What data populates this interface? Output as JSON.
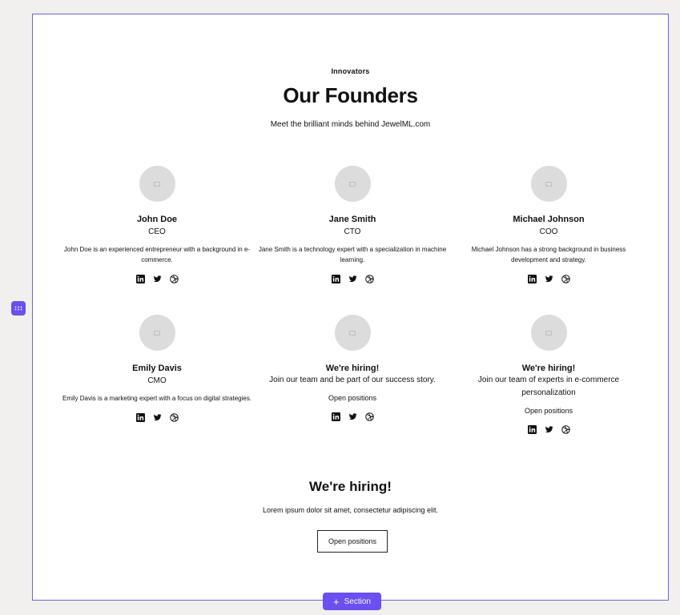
{
  "header": {
    "eyebrow": "Innovators",
    "title": "Our Founders",
    "subtitle": "Meet the brilliant minds behind JewelML.com"
  },
  "team": [
    {
      "name": "John Doe",
      "role": "CEO",
      "bio": "John Doe is an experienced entrepreneur with a background in e-commerce.",
      "socials": [
        "linkedin-icon",
        "twitter-icon",
        "dribbble-icon"
      ]
    },
    {
      "name": "Jane Smith",
      "role": "CTO",
      "bio": "Jane Smith is a technology expert with a specialization in machine learning.",
      "socials": [
        "linkedin-icon",
        "twitter-icon",
        "dribbble-icon"
      ]
    },
    {
      "name": "Michael Johnson",
      "role": "COO",
      "bio": "Michael Johnson has a strong background in business development and strategy.",
      "socials": [
        "linkedin-icon",
        "twitter-icon",
        "dribbble-icon"
      ]
    },
    {
      "name": "Emily Davis",
      "role": "CMO",
      "bio": "Emily Davis is a marketing expert with a focus on digital strategies.",
      "socials": [
        "linkedin-icon",
        "twitter-icon",
        "dribbble-icon"
      ]
    }
  ],
  "hiring_cards": [
    {
      "title": "We're hiring!",
      "text": "Join our team and be part of our success story.",
      "link": "Open positions"
    },
    {
      "title": "We're hiring!",
      "text": "Join our team of experts in e-commerce personalization",
      "link": "Open positions"
    }
  ],
  "cta": {
    "title": "We're hiring!",
    "text": "Lorem ipsum dolor sit amet, consectetur adipiscing elit.",
    "button": "Open positions"
  },
  "editor": {
    "add_section_label": "Section",
    "accent": "#6b4ff0",
    "border": "#6d5ff2"
  }
}
